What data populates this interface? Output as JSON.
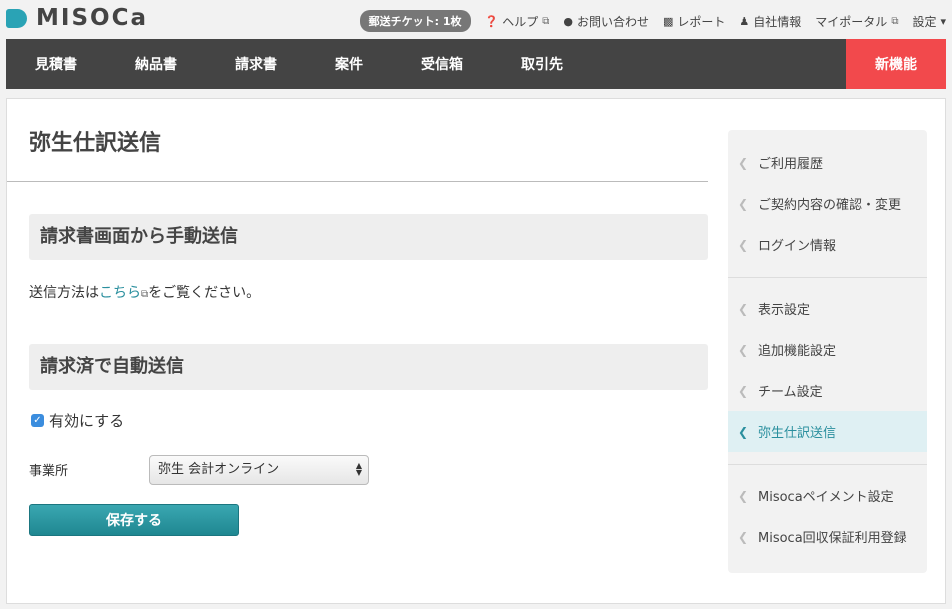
{
  "header": {
    "logo_text": "MISOCa",
    "ticket": "郵送チケット: 1枚",
    "links": [
      {
        "icon": "help-icon",
        "glyph": "❓",
        "label": "ヘルプ",
        "external": true
      },
      {
        "icon": "chat-icon",
        "glyph": "💬",
        "label": "お問い合わせ",
        "external": false
      },
      {
        "icon": "report-icon",
        "glyph": "📊",
        "label": "レポート",
        "external": false
      },
      {
        "icon": "user-icon",
        "glyph": "👤",
        "label": "自社情報",
        "external": false
      },
      {
        "icon": "portal-icon",
        "glyph": "",
        "label": "マイポータル",
        "external": true
      },
      {
        "icon": "settings-icon",
        "glyph": "",
        "label": "設定",
        "external": false
      }
    ],
    "external_glyph": "⧉",
    "dropdown_glyph": "▾"
  },
  "nav": {
    "items": [
      "見積書",
      "納品書",
      "請求書",
      "案件",
      "受信箱",
      "取引先"
    ],
    "new_label": "新機能"
  },
  "main": {
    "title": "弥生仕訳送信",
    "manual_heading": "請求書画面から手動送信",
    "manual_prefix": "送信方法は",
    "manual_link": "こちら",
    "manual_suffix": "をご覧ください。",
    "auto_heading": "請求済で自動送信",
    "enable_label": "有効にする",
    "enable_checked": true,
    "office_label": "事業所",
    "office_value": "弥生 会計オンライン",
    "save_label": "保存する"
  },
  "sidebar": {
    "items": [
      {
        "label": "ご利用履歴",
        "active": false
      },
      {
        "label": "ご契約内容の確認・変更",
        "active": false
      },
      {
        "label": "ログイン情報",
        "active": false
      },
      {
        "label": "表示設定",
        "active": false
      },
      {
        "label": "追加機能設定",
        "active": false
      },
      {
        "label": "チーム設定",
        "active": false
      },
      {
        "label": "弥生仕訳送信",
        "active": true
      },
      {
        "label": "Misocaペイメント設定",
        "active": false
      },
      {
        "label": "Misoca回収保証利用登録",
        "active": false
      }
    ]
  },
  "colors": {
    "accent": "#2aa3b5",
    "nav_bg": "#444444",
    "new_bg": "#f2494c",
    "link": "#2a8f9e",
    "sidebar_active_bg": "#dff0f3"
  }
}
